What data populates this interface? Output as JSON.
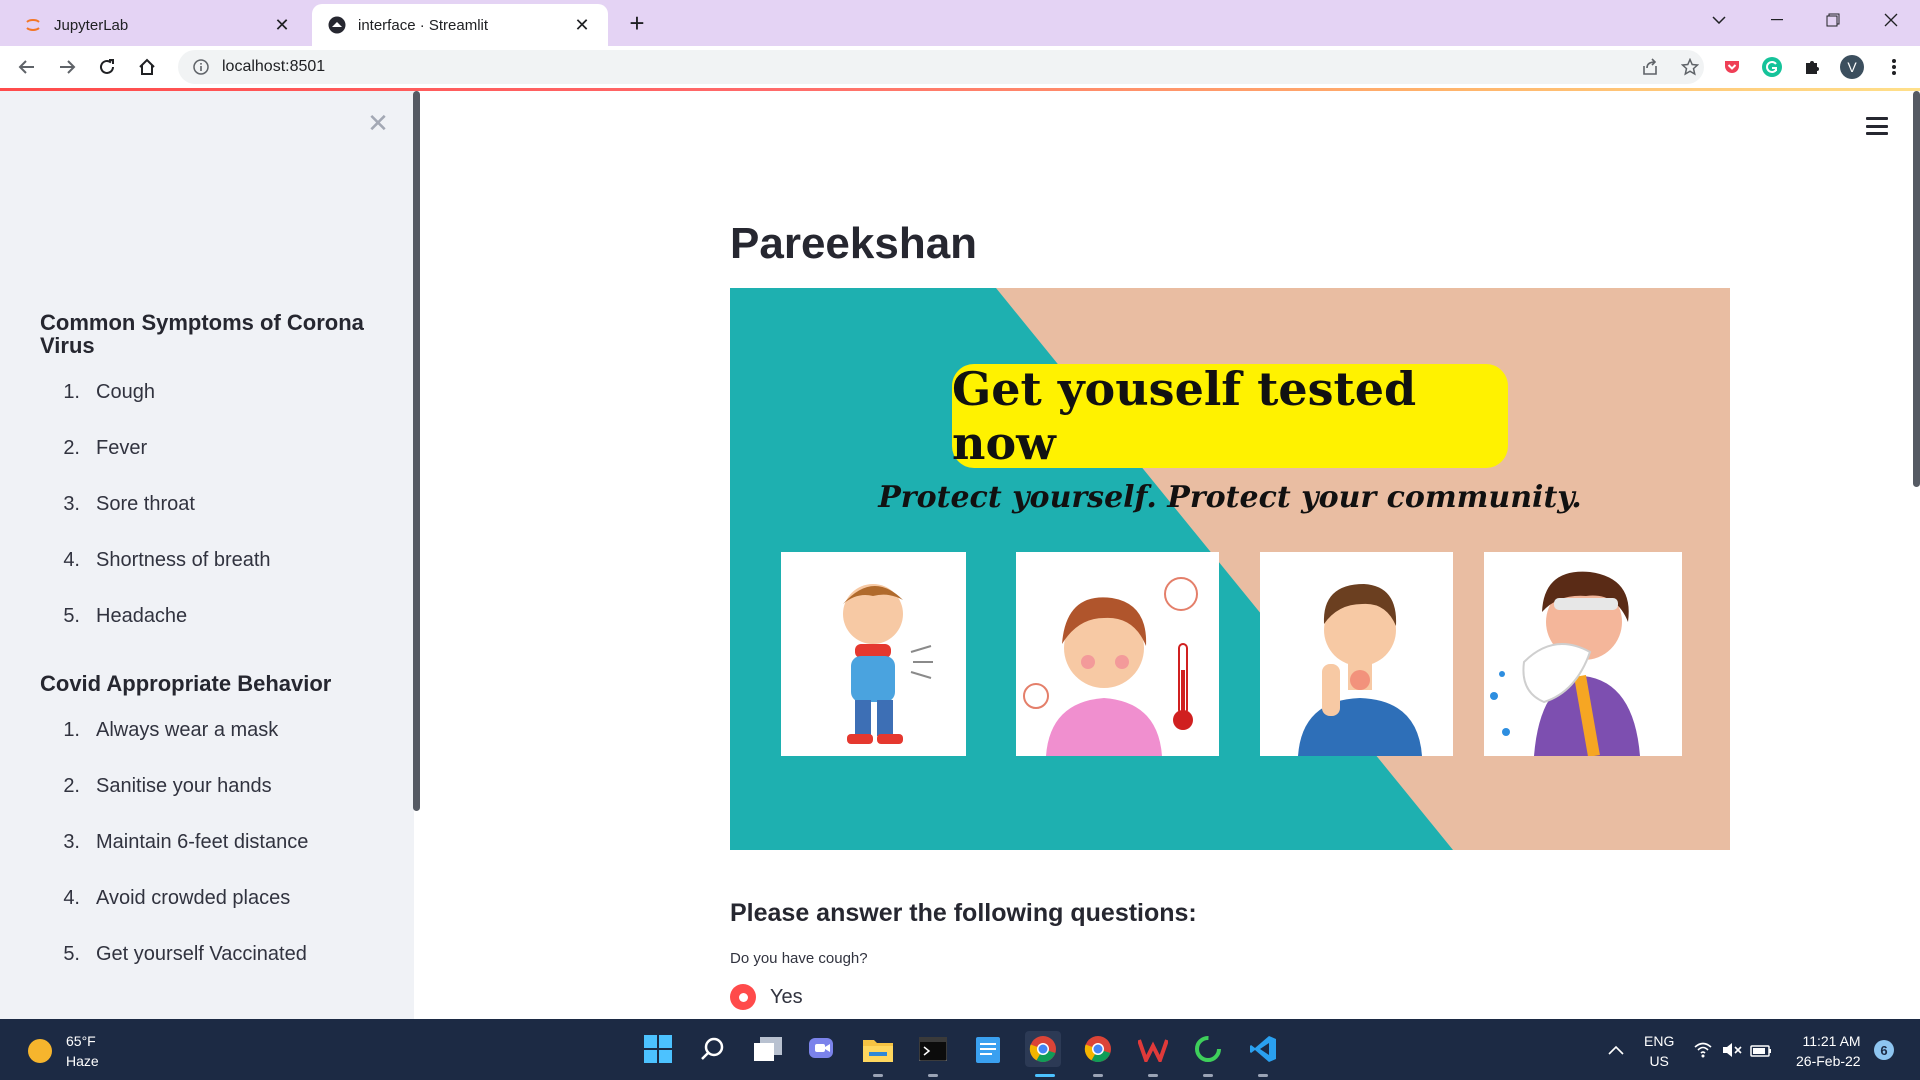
{
  "browser": {
    "tabs": [
      {
        "title": "JupyterLab",
        "active": false
      },
      {
        "title": "interface · Streamlit",
        "active": true
      }
    ],
    "url": "localhost:8501",
    "profile_initial": "V"
  },
  "sidebar": {
    "sections": [
      {
        "heading": "Common Symptoms of Corona Virus",
        "items": [
          {
            "num": "1.",
            "label": "Cough"
          },
          {
            "num": "2.",
            "label": "Fever"
          },
          {
            "num": "3.",
            "label": "Sore throat"
          },
          {
            "num": "4.",
            "label": "Shortness of breath"
          },
          {
            "num": "5.",
            "label": "Headache"
          }
        ]
      },
      {
        "heading": "Covid Appropriate Behavior",
        "items": [
          {
            "num": "1.",
            "label": "Always wear a mask"
          },
          {
            "num": "2.",
            "label": "Sanitise your hands"
          },
          {
            "num": "3.",
            "label": "Maintain 6-feet distance"
          },
          {
            "num": "4.",
            "label": "Avoid crowded places"
          },
          {
            "num": "5.",
            "label": "Get yourself Vaccinated"
          }
        ]
      }
    ]
  },
  "main": {
    "title": "Pareekshan",
    "banner": {
      "headline": "Get youself tested now",
      "tagline": "Protect yourself. Protect your community.",
      "colors": {
        "teal": "#1eb0b0",
        "peach": "#e9bda2",
        "yellow": "#fff200"
      }
    },
    "questions_heading": "Please answer the following questions:",
    "question": "Do you have cough?",
    "selected_option": "Yes",
    "accent_color": "#ff4b4b"
  },
  "taskbar": {
    "weather_temp": "65°F",
    "weather_desc": "Haze",
    "language": "ENG",
    "region": "US",
    "time": "11:21 AM",
    "date": "26-Feb-22",
    "notifications": "6"
  }
}
